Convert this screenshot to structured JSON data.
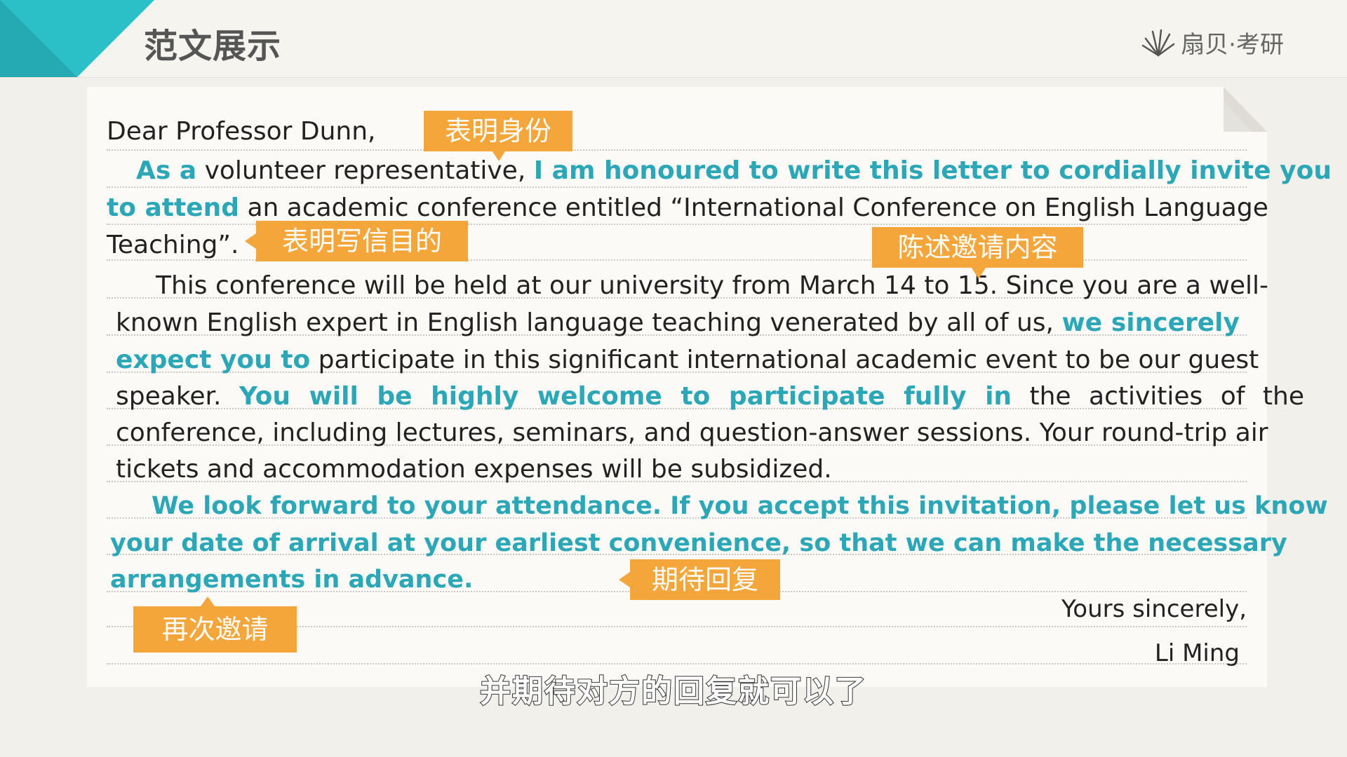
{
  "header": {
    "title": "范文展示",
    "brand": "扇贝·考研",
    "colors": {
      "accent": "#2bbfc8",
      "tag": "#f5a63a",
      "highlight": "#2ba7b7"
    }
  },
  "letter": {
    "salutation": "Dear Professor Dunn,",
    "p1_l1_a": "As a",
    "p1_l1_b": " volunteer representative, ",
    "p1_l1_c": "I am honoured to write this letter to cordially invite you",
    "p1_l2_a": "to attend",
    "p1_l2_b": " an academic conference entitled “International Conference on English Language",
    "p1_l3": "Teaching”.",
    "p2_l1": "This conference will be held at our university from March 14 to 15. Since you are a well-",
    "p2_l2_a": "known English expert in English language teaching venerated by all of us, ",
    "p2_l2_b": "we sincerely",
    "p2_l3_a": "expect you to",
    "p2_l3_b": " participate in this significant international academic event to be our guest",
    "p2_l4_a": "speaker. ",
    "p2_l4_b": "You will be highly welcome to participate fully in",
    "p2_l4_c": " the activities of the",
    "p2_l5": "conference, including lectures, seminars, and question-answer sessions. Your round-trip air",
    "p2_l6": "tickets and accommodation expenses will be subsidized.",
    "p3_l1": "We look forward to your attendance. If you accept this invitation, please let us know",
    "p3_l2": "your date of arrival at your earliest convenience, so that we can make the necessary",
    "p3_l3": "arrangements in advance.",
    "closing": "Yours sincerely,",
    "signature": "Li Ming"
  },
  "tags": {
    "identity": "表明身份",
    "purpose": "表明写信目的",
    "content": "陈述邀请内容",
    "reply": "期待回复",
    "again": "再次邀请"
  },
  "subtitle": "并期待对方的回复就可以了"
}
